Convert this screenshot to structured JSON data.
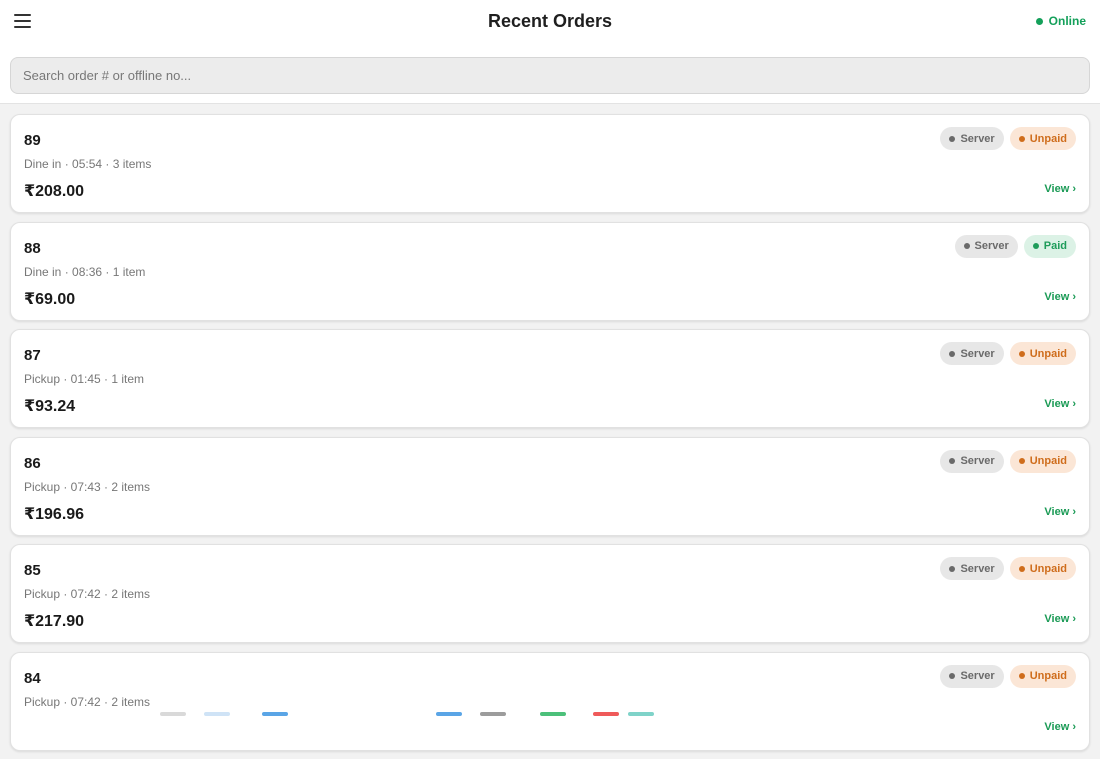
{
  "header": {
    "title": "Recent Orders",
    "status_label": "Online",
    "menu_icon": "menu-icon"
  },
  "search": {
    "placeholder": "Search order # or offline no..."
  },
  "orders": [
    {
      "number": "89",
      "meta": "Dine in · 05:54 · 3 items",
      "amount": "₹208.00",
      "source_badge": "Server",
      "payment_badge": "Unpaid",
      "view_label": "View ›"
    },
    {
      "number": "88",
      "meta": "Dine in · 08:36 · 1 item",
      "amount": "₹69.00",
      "source_badge": "Server",
      "payment_badge": "Paid",
      "view_label": "View ›"
    },
    {
      "number": "87",
      "meta": "Pickup · 01:45 · 1 item",
      "amount": "₹93.24",
      "source_badge": "Server",
      "payment_badge": "Unpaid",
      "view_label": "View ›"
    },
    {
      "number": "86",
      "meta": "Pickup · 07:43 · 2 items",
      "amount": "₹196.96",
      "source_badge": "Server",
      "payment_badge": "Unpaid",
      "view_label": "View ›"
    },
    {
      "number": "85",
      "meta": "Pickup · 07:42 · 2 items",
      "amount": "₹217.90",
      "source_badge": "Server",
      "payment_badge": "Unpaid",
      "view_label": "View ›"
    },
    {
      "number": "84",
      "meta": "Pickup · 07:42 · 2 items",
      "amount": "",
      "source_badge": "Server",
      "payment_badge": "Unpaid",
      "view_label": "View ›"
    }
  ],
  "colors": {
    "online": "#14a05a",
    "unpaid": "#cf6d1c",
    "paid": "#1e9c5a",
    "view_link": "#1a9a55"
  }
}
